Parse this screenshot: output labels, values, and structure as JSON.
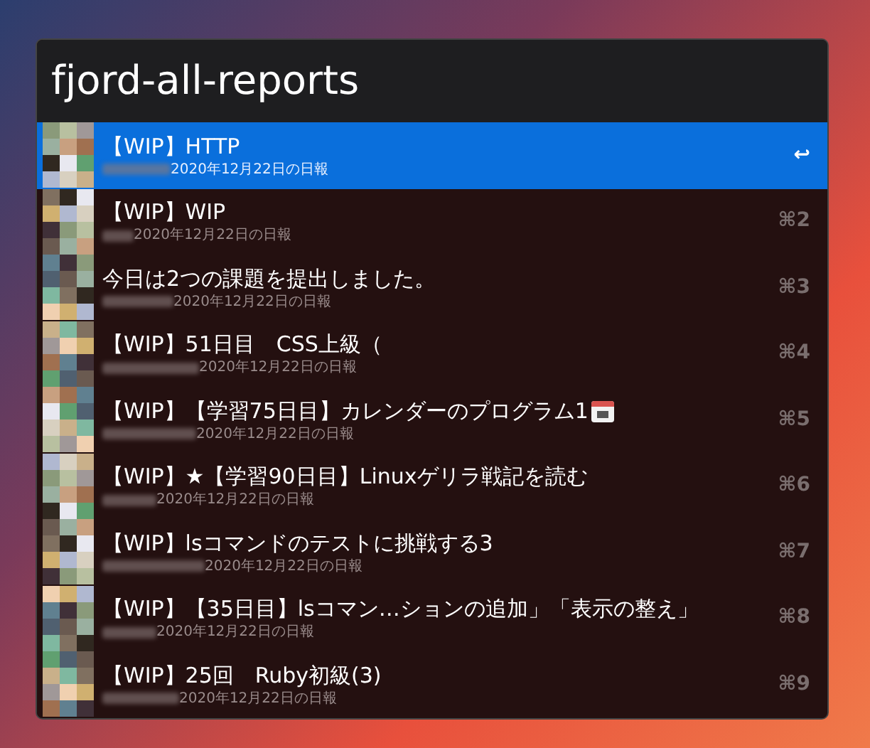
{
  "search": {
    "value": "fjord-all-reports"
  },
  "results": [
    {
      "title": "【WIP】HTTP",
      "subtitle": "2020年12月22日の日報",
      "shortcut": "↩",
      "selected": true,
      "kind": "plain"
    },
    {
      "title": "【WIP】WIP",
      "subtitle": "2020年12月22日の日報",
      "shortcut": "⌘2",
      "selected": false,
      "kind": "plain"
    },
    {
      "title": "今日は2つの課題を提出しました。",
      "subtitle": "2020年12月22日の日報",
      "shortcut": "⌘3",
      "selected": false,
      "kind": "plain"
    },
    {
      "title": "【WIP】51日目　CSS上級（",
      "subtitle": "2020年12月22日の日報",
      "shortcut": "⌘4",
      "selected": false,
      "kind": "plain"
    },
    {
      "title": "【WIP】【学習75日目】カレンダーのプログラム1",
      "subtitle": "2020年12月22日の日報",
      "shortcut": "⌘5",
      "selected": false,
      "kind": "calendar-emoji"
    },
    {
      "title": "【WIP】★【学習90日目】Linuxゲリラ戦記を読む",
      "subtitle": "2020年12月22日の日報",
      "shortcut": "⌘6",
      "selected": false,
      "kind": "plain"
    },
    {
      "title": "【WIP】lsコマンドのテストに挑戦する3",
      "subtitle": "2020年12月22日の日報",
      "shortcut": "⌘7",
      "selected": false,
      "kind": "plain"
    },
    {
      "title": "【WIP】【35日目】lsコマン…ションの追加」「表示の整え」",
      "subtitle": "2020年12月22日の日報",
      "shortcut": "⌘8",
      "selected": false,
      "kind": "plain"
    },
    {
      "title": "【WIP】25回　Ruby初級(3)",
      "subtitle": "2020年12月22日の日報",
      "shortcut": "⌘9",
      "selected": false,
      "kind": "plain"
    }
  ]
}
